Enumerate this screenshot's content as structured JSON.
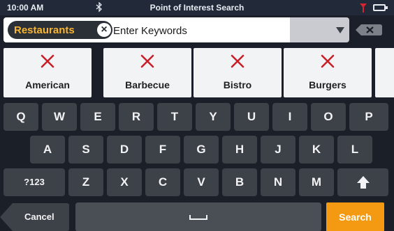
{
  "status_bar": {
    "time": "10:00 AM",
    "title": "Point of Interest Search",
    "icons": [
      "bluetooth-icon",
      "signal-icon",
      "battery-icon"
    ]
  },
  "search": {
    "category_chip": "Restaurants",
    "keyword_placeholder": "Enter Keywords",
    "keyword_value": ""
  },
  "categories": [
    {
      "label": "American",
      "icon": "fork-knife-icon"
    },
    {
      "label": "Barbecue",
      "icon": "fork-knife-icon"
    },
    {
      "label": "Bistro",
      "icon": "fork-knife-icon"
    },
    {
      "label": "Burgers",
      "icon": "fork-knife-icon"
    }
  ],
  "keyboard": {
    "row1": [
      "Q",
      "W",
      "E",
      "R",
      "T",
      "Y",
      "U",
      "I",
      "O",
      "P"
    ],
    "row2": [
      "A",
      "S",
      "D",
      "F",
      "G",
      "H",
      "J",
      "K",
      "L"
    ],
    "row3": [
      "?123",
      "Z",
      "X",
      "C",
      "V",
      "B",
      "N",
      "M"
    ],
    "cancel_label": "Cancel",
    "search_label": "Search"
  },
  "colors": {
    "chip_text": "#f8b531",
    "search_key": "#f39a12",
    "icon_red": "#c8202a",
    "key_bg": "#3d4148"
  }
}
